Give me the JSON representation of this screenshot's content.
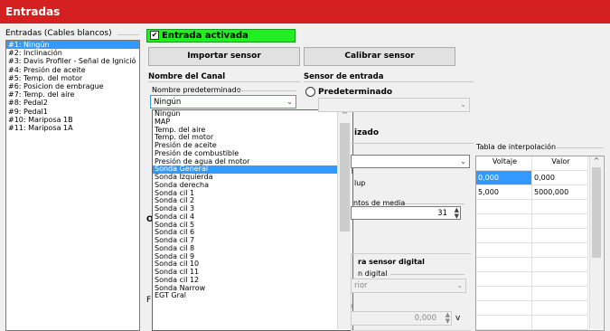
{
  "window": {
    "title": "Entradas"
  },
  "inputs_list": {
    "label": "Entradas (Cables blancos)",
    "items": [
      "#1: Ningún",
      "#2: Inclinación",
      "#3: Davis Profiler - Señal de Ignició",
      "#4: Presión de aceite",
      "#5: Temp. del motor",
      "#6: Posicion de embrague",
      "#7: Temp. del aire",
      "#8: Pedal2",
      "#9: Pedal1",
      "#10: Mariposa 1B",
      "#11: Mariposa 1A"
    ],
    "selected_index": 0
  },
  "active_checkbox": {
    "label": "Entrada activada",
    "checked": true,
    "mark": "✔"
  },
  "buttons": {
    "import": "Importar sensor",
    "calibrate": "Calibrar sensor"
  },
  "channel": {
    "title": "Nombre del Canal",
    "default_name_label": "Nombre predeterminado",
    "selected": "Ningún",
    "options": [
      "Ningún",
      "MAP",
      "Temp. del aire",
      "Temp. del motor",
      "Presión de aceite",
      "Presión de combustible",
      "Presión de agua del motor",
      "Sonda General",
      "Sonda Izquierda",
      "Sonda derecha",
      "Sonda cil 1",
      "Sonda cil 2",
      "Sonda cil 3",
      "Sonda cil 4",
      "Sonda cil 5",
      "Sonda cil 6",
      "Sonda cil 7",
      "Sonda cil 8",
      "Sonda cil 9",
      "Sonda cil 10",
      "Sonda cil 11",
      "Sonda cil 12",
      "Sonda Narrow",
      "EGT Gral"
    ],
    "highlighted_index": 7
  },
  "sensor": {
    "title": "Sensor de entrada",
    "predeterminado": "Predeterminado",
    "personalizado_partial": "izado",
    "pullup_partial": "lup",
    "avg_points_partial": "ntos de media",
    "avg_value": "31",
    "digital_title_partial": "ra sensor digital",
    "digital_label_partial": "n digital",
    "digital_value_partial": "rior",
    "voltage_value": "0,000",
    "voltage_unit": "v"
  },
  "interp_table": {
    "label": "Tabla de interpolación",
    "columns": [
      "Voltaje",
      "Valor"
    ],
    "rows": [
      [
        "0,000",
        "0,000"
      ],
      [
        "5,000",
        "5000,000"
      ]
    ]
  },
  "partial_labels": {
    "o": "O",
    "f": "F"
  },
  "colors": {
    "titlebar": "#d42020",
    "active": "#22ee22",
    "selection": "#3399ff"
  }
}
